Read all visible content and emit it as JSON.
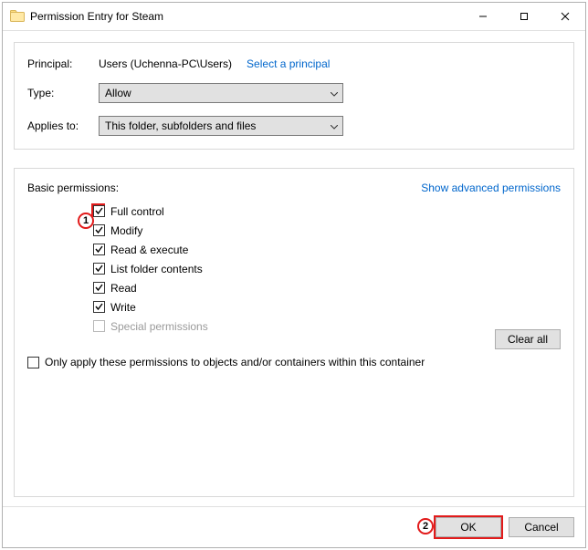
{
  "window": {
    "title": "Permission Entry for Steam"
  },
  "top": {
    "principal_label": "Principal:",
    "principal_value": "Users (Uchenna-PC\\Users)",
    "select_principal": "Select a principal",
    "type_label": "Type:",
    "type_value": "Allow",
    "applies_label": "Applies to:",
    "applies_value": "This folder, subfolders and files"
  },
  "perm": {
    "heading": "Basic permissions:",
    "advanced_link": "Show advanced permissions",
    "items": [
      {
        "label": "Full control",
        "checked": true
      },
      {
        "label": "Modify",
        "checked": true
      },
      {
        "label": "Read & execute",
        "checked": true
      },
      {
        "label": "List folder contents",
        "checked": true
      },
      {
        "label": "Read",
        "checked": true
      },
      {
        "label": "Write",
        "checked": true
      },
      {
        "label": "Special permissions",
        "checked": false,
        "disabled": true
      }
    ],
    "only_apply": {
      "label": "Only apply these permissions to objects and/or containers within this container",
      "checked": false
    },
    "clear_all": "Clear all"
  },
  "footer": {
    "ok": "OK",
    "cancel": "Cancel"
  },
  "annotations": {
    "a1": "1",
    "a2": "2"
  }
}
